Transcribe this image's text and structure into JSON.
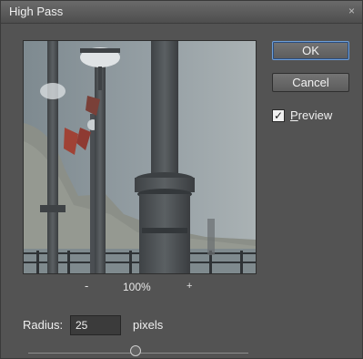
{
  "dialog": {
    "title": "High Pass",
    "close_glyph": "×"
  },
  "buttons": {
    "ok_label": "OK",
    "cancel_label": "Cancel"
  },
  "preview_option": {
    "label": "Preview",
    "checked": true,
    "check_glyph": "✓"
  },
  "zoom": {
    "minus_glyph": "-",
    "value": "100%",
    "plus_glyph": "+"
  },
  "radius": {
    "label": "Radius:",
    "value": "25",
    "unit": "pixels"
  },
  "colors": {
    "dialog_bg": "#535353",
    "default_button_border": "#6f9fd8"
  }
}
